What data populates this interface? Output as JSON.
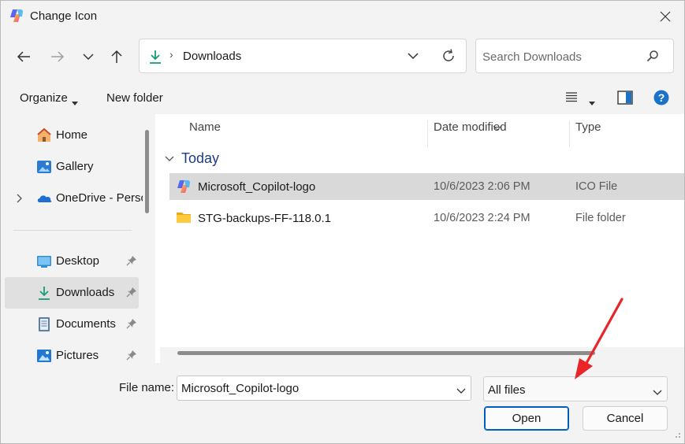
{
  "window": {
    "title": "Change Icon"
  },
  "nav": {
    "path": "Downloads",
    "search_placeholder": "Search Downloads"
  },
  "toolbar": {
    "organize_label": "Organize",
    "new_folder_label": "New folder"
  },
  "sidebar": {
    "items": [
      {
        "label": "Home",
        "icon": "home-icon"
      },
      {
        "label": "Gallery",
        "icon": "gallery-icon"
      },
      {
        "label": "OneDrive - Personal",
        "icon": "onedrive-icon"
      },
      {
        "label": "Desktop",
        "icon": "desktop-icon",
        "pinned": true
      },
      {
        "label": "Downloads",
        "icon": "downloads-icon",
        "pinned": true,
        "selected": true
      },
      {
        "label": "Documents",
        "icon": "documents-icon",
        "pinned": true
      },
      {
        "label": "Pictures",
        "icon": "pictures-icon",
        "pinned": true
      }
    ]
  },
  "content": {
    "columns": [
      "Name",
      "Date modified",
      "Type"
    ],
    "group": "Today",
    "rows": [
      {
        "name": "Microsoft_Copilot-logo",
        "date": "10/6/2023 2:06 PM",
        "type": "ICO File",
        "icon": "copilot-icon",
        "selected": true
      },
      {
        "name": "STG-backups-FF-118.0.1",
        "date": "10/6/2023 2:24 PM",
        "type": "File folder",
        "icon": "folder-icon",
        "selected": false
      }
    ]
  },
  "footer": {
    "file_name_label": "File name:",
    "file_name_value": "Microsoft_Copilot-logo",
    "file_type_value": "All files",
    "open_label": "Open",
    "cancel_label": "Cancel"
  },
  "colors": {
    "accent": "#005fb8",
    "annotation_arrow": "#e8262a",
    "selection": "#d9d9d9"
  }
}
